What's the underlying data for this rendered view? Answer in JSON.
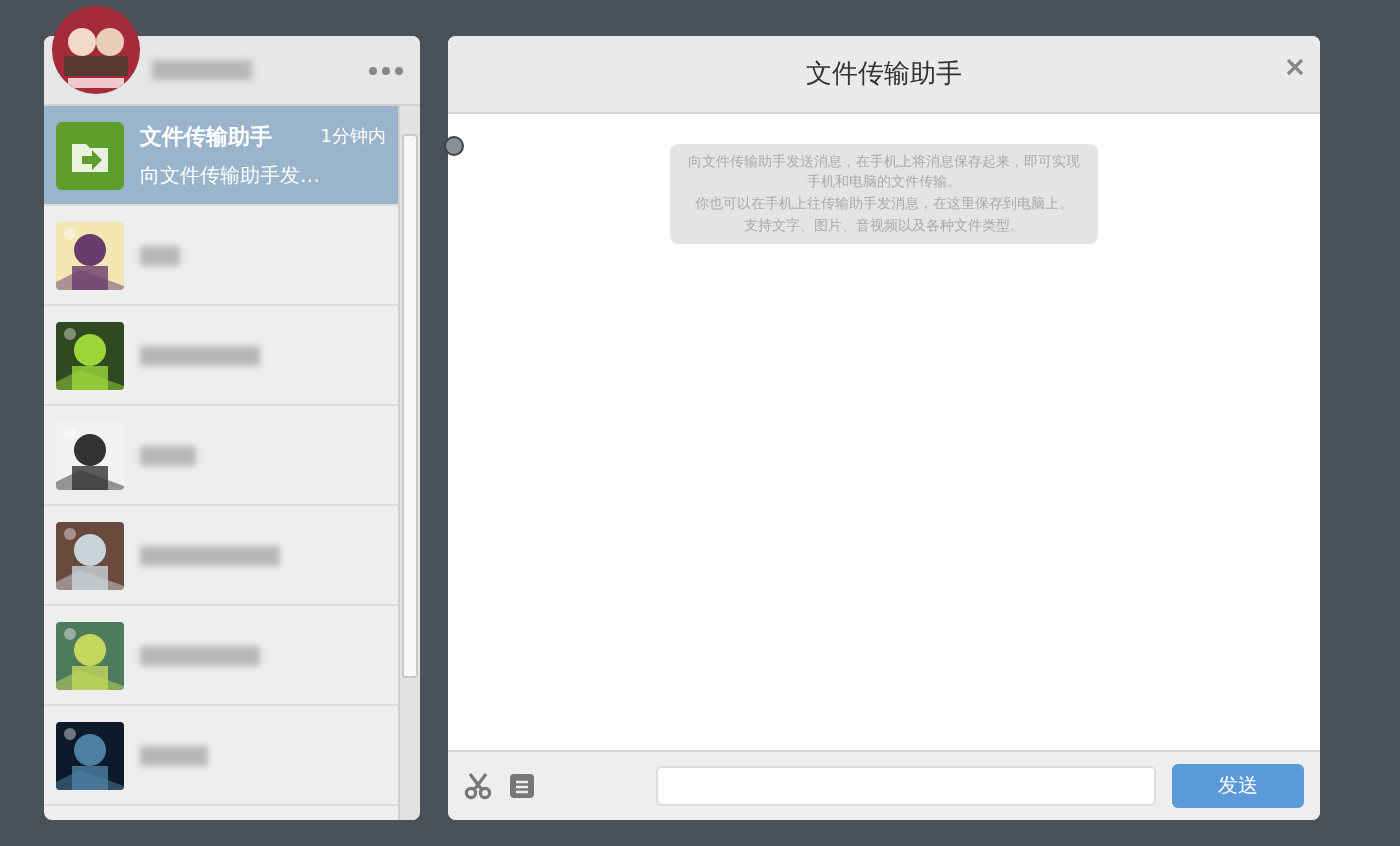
{
  "chat": {
    "title": "文件传输助手",
    "notice": [
      "向文件传输助手发送消息，在手机上将消息保存起来，即可实现手机和电脑的文件传输。",
      "你也可以在手机上往传输助手发消息，在这里保存到电脑上。",
      "支持文字、图片、音视频以及各种文件类型。"
    ],
    "send_label": "发送"
  },
  "contacts": [
    {
      "kind": "file",
      "name": "文件传输助手",
      "time": "1分钟内",
      "preview": "向文件传输助手发…",
      "selected": true
    },
    {
      "kind": "blurred",
      "selected": false
    },
    {
      "kind": "blurred",
      "selected": false
    },
    {
      "kind": "blurred",
      "selected": false
    },
    {
      "kind": "blurred",
      "selected": false
    },
    {
      "kind": "blurred",
      "selected": false
    },
    {
      "kind": "blurred",
      "selected": false
    }
  ]
}
